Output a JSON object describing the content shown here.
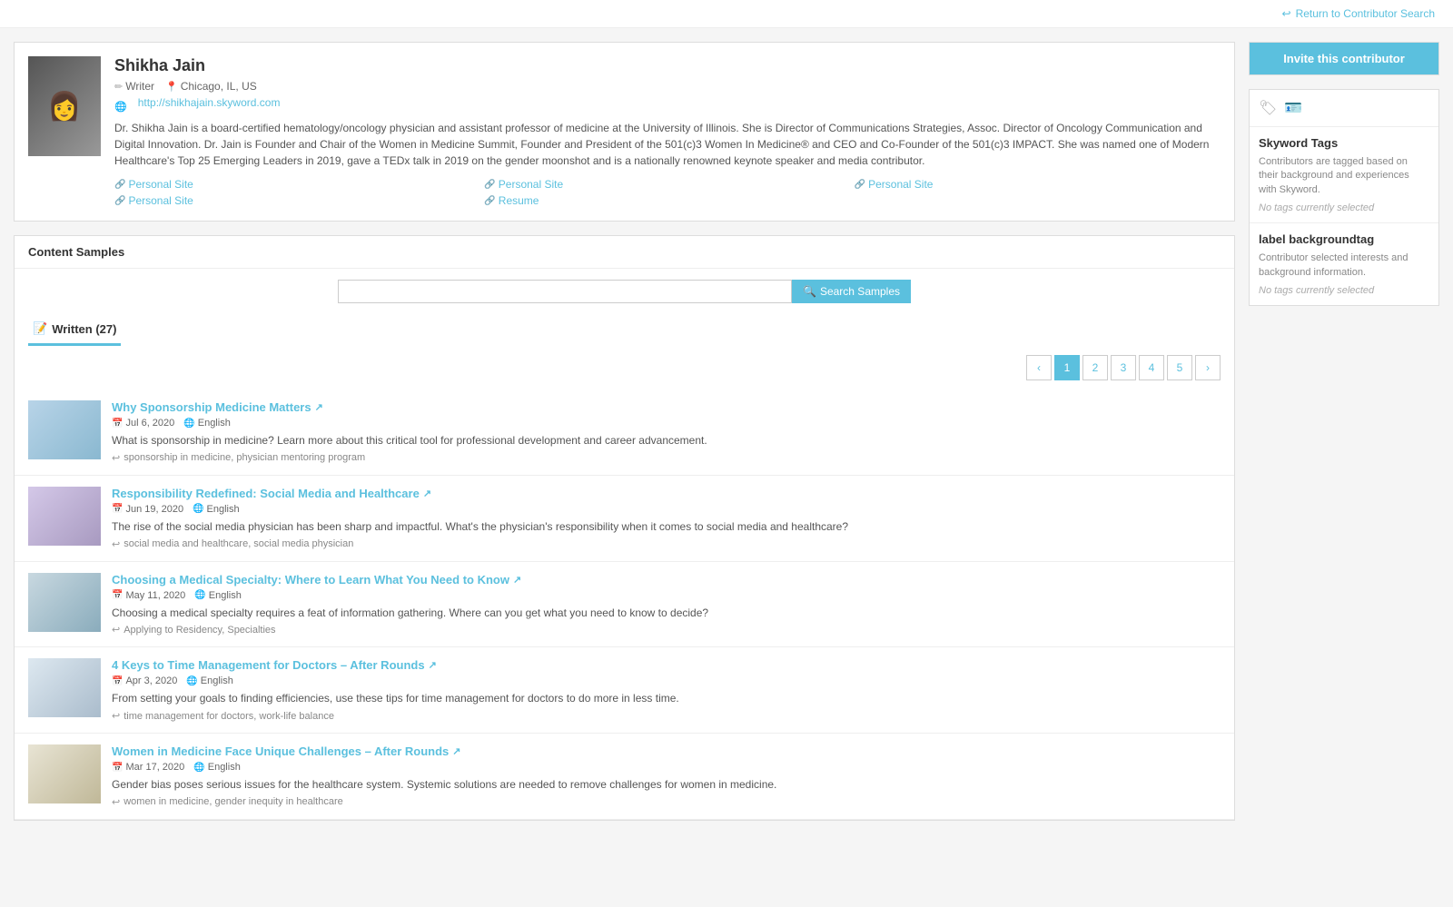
{
  "topbar": {
    "return_link": "Return to Contributor Search"
  },
  "profile": {
    "name": "Shikha Jain",
    "role": "Writer",
    "location": "Chicago, IL, US",
    "website": "http://shikhajain.skyword.com",
    "bio": "Dr. Shikha Jain is a board-certified hematology/oncology physician and assistant professor of medicine at the University of Illinois. She is Director of Communications Strategies, Assoc. Director of Oncology Communication and Digital Innovation. Dr. Jain is Founder and Chair of the Women in Medicine Summit, Founder and President of the 501(c)3 Women In Medicine® and CEO and Co-Founder of the 501(c)3 IMPACT. She was named one of Modern Healthcare's Top 25 Emerging Leaders in 2019, gave a TEDx talk in 2019 on the gender moonshot and is a nationally renowned keynote speaker and media contributor.",
    "links": [
      {
        "label": "Personal Site"
      },
      {
        "label": "Personal Site"
      },
      {
        "label": "Personal Site"
      },
      {
        "label": "Personal Site"
      },
      {
        "label": "Resume"
      }
    ]
  },
  "content_samples": {
    "header": "Content Samples",
    "search_placeholder": "",
    "search_button": "Search Samples"
  },
  "tabs": [
    {
      "label": "Written (27)",
      "icon": "📝",
      "active": true
    }
  ],
  "pagination": {
    "prev": "‹",
    "next": "›",
    "pages": [
      "1",
      "2",
      "3",
      "4",
      "5"
    ],
    "current": "1"
  },
  "articles": [
    {
      "title": "Why Sponsorship Medicine Matters",
      "date": "Jul 6, 2020",
      "language": "English",
      "description": "What is sponsorship in medicine? Learn more about this critical tool for professional development and career advancement.",
      "tags": "sponsorship in medicine, physician mentoring program",
      "thumb_class": "thumb-1"
    },
    {
      "title": "Responsibility Redefined: Social Media and Healthcare",
      "date": "Jun 19, 2020",
      "language": "English",
      "description": "The rise of the social media physician has been sharp and impactful. What's the physician's responsibility when it comes to social media and healthcare?",
      "tags": "social media and healthcare, social media physician",
      "thumb_class": "thumb-2"
    },
    {
      "title": "Choosing a Medical Specialty: Where to Learn What You Need to Know",
      "date": "May 11, 2020",
      "language": "English",
      "description": "Choosing a medical specialty requires a feat of information gathering. Where can you get what you need to know to decide?",
      "tags": "Applying to Residency, Specialties",
      "thumb_class": "thumb-3"
    },
    {
      "title": "4 Keys to Time Management for Doctors – After Rounds",
      "date": "Apr 3, 2020",
      "language": "English",
      "description": "From setting your goals to finding efficiencies, use these tips for time management for doctors to do more in less time.",
      "tags": "time management for doctors, work-life balance",
      "thumb_class": "thumb-4"
    },
    {
      "title": "Women in Medicine Face Unique Challenges – After Rounds",
      "date": "Mar 17, 2020",
      "language": "English",
      "description": "Gender bias poses serious issues for the healthcare system. Systemic solutions are needed to remove challenges for women in medicine.",
      "tags": "women in medicine, gender inequity in healthcare",
      "thumb_class": "thumb-5"
    }
  ],
  "sidebar": {
    "invite_button": "Invite this contributor",
    "skyword_tags_title": "Skyword Tags",
    "skyword_tags_desc": "Contributors are tagged based on their background and experiences with Skyword.",
    "skyword_tags_empty": "No tags currently selected",
    "background_tag_title": "label backgroundtag",
    "background_tag_desc": "Contributor selected interests and background information.",
    "background_tag_empty": "No tags currently selected"
  }
}
